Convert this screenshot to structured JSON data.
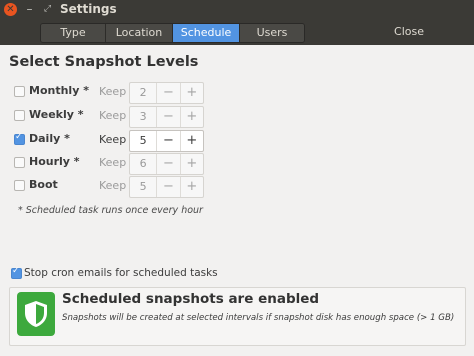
{
  "window": {
    "title": "Settings"
  },
  "tabs": [
    {
      "label": "Type",
      "active": false
    },
    {
      "label": "Location",
      "active": false
    },
    {
      "label": "Schedule",
      "active": true
    },
    {
      "label": "Users",
      "active": false
    }
  ],
  "close_label": "Close",
  "heading": "Select Snapshot Levels",
  "keep_label": "Keep",
  "levels": [
    {
      "label": "Monthly *",
      "checked": false,
      "value": "2"
    },
    {
      "label": "Weekly *",
      "checked": false,
      "value": "3"
    },
    {
      "label": "Daily *",
      "checked": true,
      "value": "5"
    },
    {
      "label": "Hourly *",
      "checked": false,
      "value": "6"
    },
    {
      "label": "Boot",
      "checked": false,
      "value": "5"
    }
  ],
  "spin_minus": "−",
  "spin_plus": "+",
  "note": "* Scheduled task runs once every hour",
  "cron_label": "Stop cron emails for scheduled tasks",
  "cron_checked": true,
  "status": {
    "title": "Scheduled snapshots are enabled",
    "description": "Snapshots will be created at selected intervals if snapshot disk has enough space (> 1 GB)",
    "icon": "shield-icon"
  },
  "colors": {
    "accent": "#5294e2",
    "titlebar": "#3b3a36",
    "close": "#e95420",
    "shield": "#3da93d"
  }
}
